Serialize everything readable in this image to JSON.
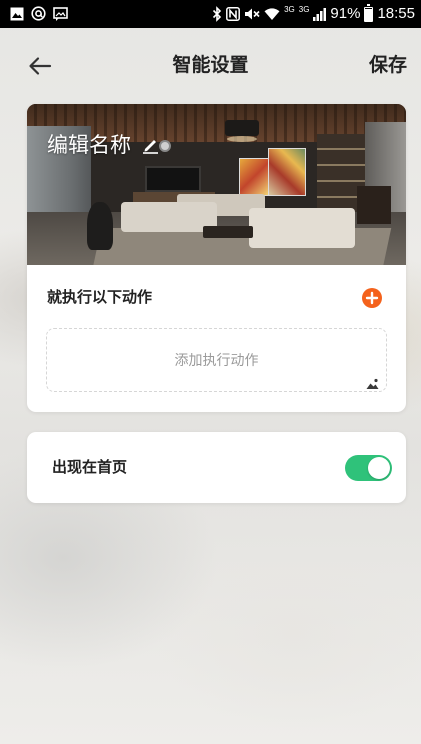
{
  "status_bar": {
    "left_icons": [
      "image-notification-icon",
      "at-sign-icon",
      "message-icon"
    ],
    "right_icons": [
      "bluetooth-icon",
      "nfc-icon",
      "mute-icon",
      "wifi-icon",
      "signal-icon",
      "battery-icon"
    ],
    "network_label_1": "3G",
    "network_label_2": "3G",
    "battery_percent": "91%",
    "battery_level": 0.91,
    "time": "18:55"
  },
  "header": {
    "back_icon": "arrow-left-icon",
    "title": "智能设置",
    "save_label": "保存"
  },
  "scene_card": {
    "name": "编辑名称",
    "edit_icon": "pencil-icon",
    "cover_icon": "image-icon",
    "actions_title": "就执行以下动作",
    "add_icon": "plus-circle-icon",
    "add_action_placeholder": "添加执行动作"
  },
  "homepage_card": {
    "label": "出现在首页",
    "toggle_on": true
  },
  "colors": {
    "accent_orange": "#f4621c",
    "toggle_green": "#2fc27a",
    "status_bar_bg": "#000000"
  }
}
